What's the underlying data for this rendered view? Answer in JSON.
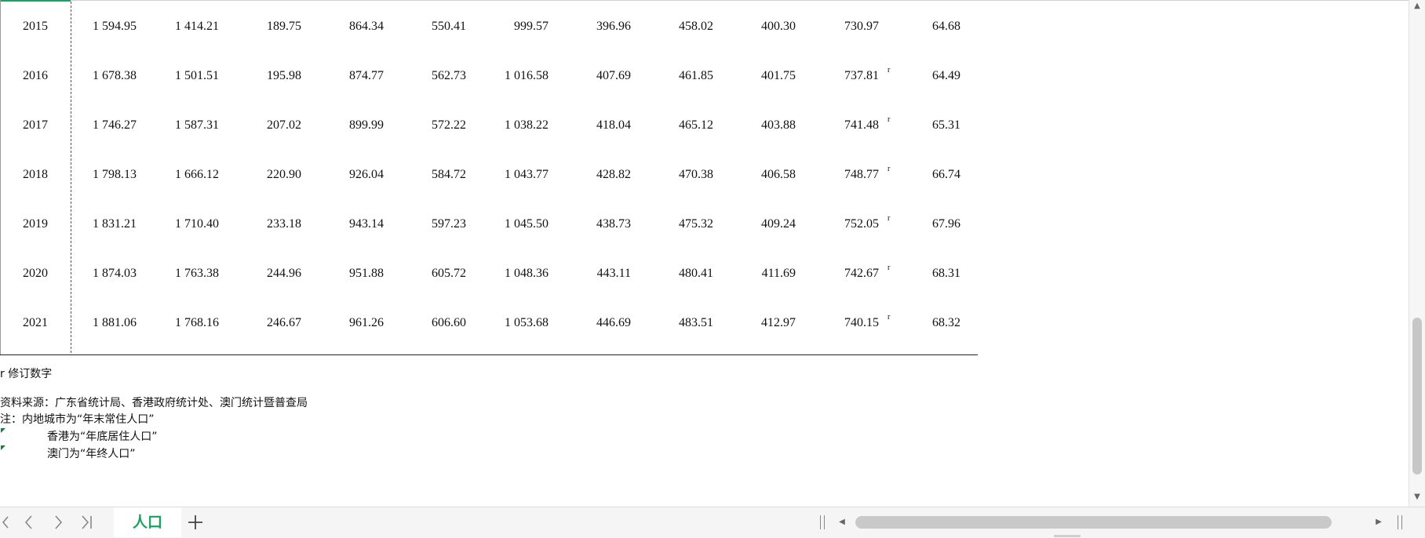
{
  "sheet": {
    "rows": [
      {
        "year": "2015",
        "values": [
          "1 594.95",
          "1 414.21",
          "189.75",
          "864.34",
          "550.41",
          "999.57",
          "396.96",
          "458.02",
          "400.30",
          "730.97",
          "64.68"
        ],
        "revised": ""
      },
      {
        "year": "2016",
        "values": [
          "1 678.38",
          "1 501.51",
          "195.98",
          "874.77",
          "562.73",
          "1 016.58",
          "407.69",
          "461.85",
          "401.75",
          "737.81",
          "64.49"
        ],
        "revised": "r"
      },
      {
        "year": "2017",
        "values": [
          "1 746.27",
          "1 587.31",
          "207.02",
          "899.99",
          "572.22",
          "1 038.22",
          "418.04",
          "465.12",
          "403.88",
          "741.48",
          "65.31"
        ],
        "revised": "r"
      },
      {
        "year": "2018",
        "values": [
          "1 798.13",
          "1 666.12",
          "220.90",
          "926.04",
          "584.72",
          "1 043.77",
          "428.82",
          "470.38",
          "406.58",
          "748.77",
          "66.74"
        ],
        "revised": "r"
      },
      {
        "year": "2019",
        "values": [
          "1 831.21",
          "1 710.40",
          "233.18",
          "943.14",
          "597.23",
          "1 045.50",
          "438.73",
          "475.32",
          "409.24",
          "752.05",
          "67.96"
        ],
        "revised": "r"
      },
      {
        "year": "2020",
        "values": [
          "1 874.03",
          "1 763.38",
          "244.96",
          "951.88",
          "605.72",
          "1 048.36",
          "443.11",
          "480.41",
          "411.69",
          "742.67",
          "68.31"
        ],
        "revised": "r"
      },
      {
        "year": "2021",
        "values": [
          "1 881.06",
          "1 768.16",
          "246.67",
          "961.26",
          "606.60",
          "1 053.68",
          "446.69",
          "483.51",
          "412.97",
          "740.15",
          "68.32"
        ],
        "revised": "r"
      }
    ]
  },
  "notes": {
    "revised_legend": "r 修订数字",
    "source": "资料来源：广东省统计局、香港政府统计处、澳门统计暨普查局",
    "note_mainland": "注：内地城市为“年末常住人口”",
    "note_hk": "香港为“年底居住人口”",
    "note_macao": "澳门为“年终人口”"
  },
  "tabs": {
    "active_label": "人口",
    "add_label": "+"
  },
  "icons": {
    "first_sheet": "chevron-first-icon",
    "prev_sheet": "chevron-left-icon",
    "next_sheet": "chevron-right-icon",
    "last_sheet": "chevron-last-icon",
    "add_sheet": "plus-icon"
  },
  "colors": {
    "accent": "#1aa260",
    "comment_marker": "#1a7a3a"
  }
}
